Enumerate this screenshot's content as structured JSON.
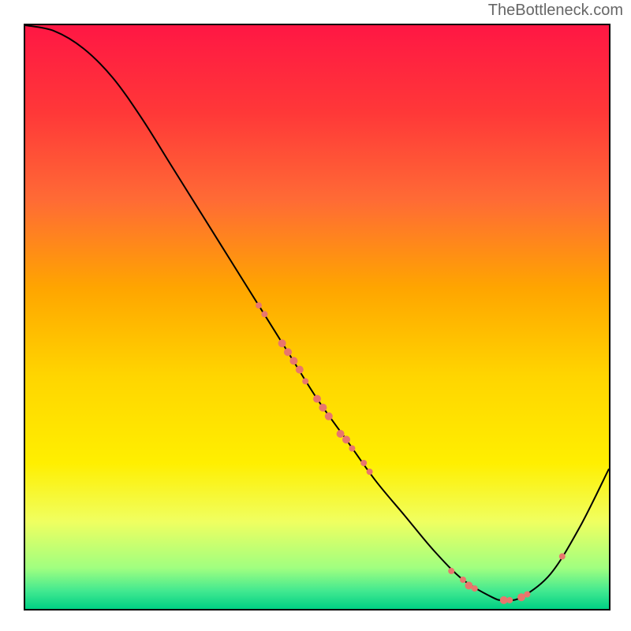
{
  "watermark": "TheBottleneck.com",
  "chart_data": {
    "type": "line",
    "title": "",
    "xlabel": "",
    "ylabel": "",
    "xlim": [
      0,
      100
    ],
    "ylim": [
      0,
      100
    ],
    "curve": {
      "x": [
        0,
        5,
        10,
        15,
        20,
        25,
        30,
        35,
        40,
        45,
        50,
        55,
        60,
        65,
        70,
        75,
        80,
        82,
        85,
        90,
        95,
        100
      ],
      "y": [
        100,
        99,
        96,
        91,
        84,
        76,
        68,
        60,
        52,
        44,
        36,
        29,
        22,
        16,
        10,
        5,
        2,
        1.5,
        2,
        6,
        14,
        24
      ]
    },
    "data_points": [
      {
        "x": 40,
        "y": 52,
        "size": 8
      },
      {
        "x": 41,
        "y": 50.5,
        "size": 8
      },
      {
        "x": 44,
        "y": 45.5,
        "size": 10
      },
      {
        "x": 45,
        "y": 44,
        "size": 10
      },
      {
        "x": 46,
        "y": 42.5,
        "size": 10
      },
      {
        "x": 47,
        "y": 41,
        "size": 10
      },
      {
        "x": 48,
        "y": 39,
        "size": 8
      },
      {
        "x": 50,
        "y": 36,
        "size": 10
      },
      {
        "x": 51,
        "y": 34.5,
        "size": 10
      },
      {
        "x": 52,
        "y": 33,
        "size": 10
      },
      {
        "x": 54,
        "y": 30,
        "size": 10
      },
      {
        "x": 55,
        "y": 29,
        "size": 10
      },
      {
        "x": 56,
        "y": 27.5,
        "size": 8
      },
      {
        "x": 58,
        "y": 25,
        "size": 8
      },
      {
        "x": 59,
        "y": 23.5,
        "size": 8
      },
      {
        "x": 73,
        "y": 6.5,
        "size": 8
      },
      {
        "x": 75,
        "y": 5,
        "size": 8
      },
      {
        "x": 76,
        "y": 4,
        "size": 10
      },
      {
        "x": 77,
        "y": 3.5,
        "size": 8
      },
      {
        "x": 82,
        "y": 1.5,
        "size": 10
      },
      {
        "x": 83,
        "y": 1.5,
        "size": 8
      },
      {
        "x": 85,
        "y": 2,
        "size": 10
      },
      {
        "x": 86,
        "y": 2.5,
        "size": 8
      },
      {
        "x": 92,
        "y": 9,
        "size": 8
      }
    ],
    "gradient_stops": [
      {
        "offset": 0,
        "color": "#ff1744"
      },
      {
        "offset": 15,
        "color": "#ff3838"
      },
      {
        "offset": 30,
        "color": "#ff6b35"
      },
      {
        "offset": 45,
        "color": "#ffa500"
      },
      {
        "offset": 60,
        "color": "#ffd500"
      },
      {
        "offset": 75,
        "color": "#ffef00"
      },
      {
        "offset": 85,
        "color": "#f0ff60"
      },
      {
        "offset": 93,
        "color": "#a0ff80"
      },
      {
        "offset": 97,
        "color": "#40e890"
      },
      {
        "offset": 100,
        "color": "#00d084"
      }
    ],
    "point_color": "#e8766d",
    "line_color": "#000000"
  }
}
